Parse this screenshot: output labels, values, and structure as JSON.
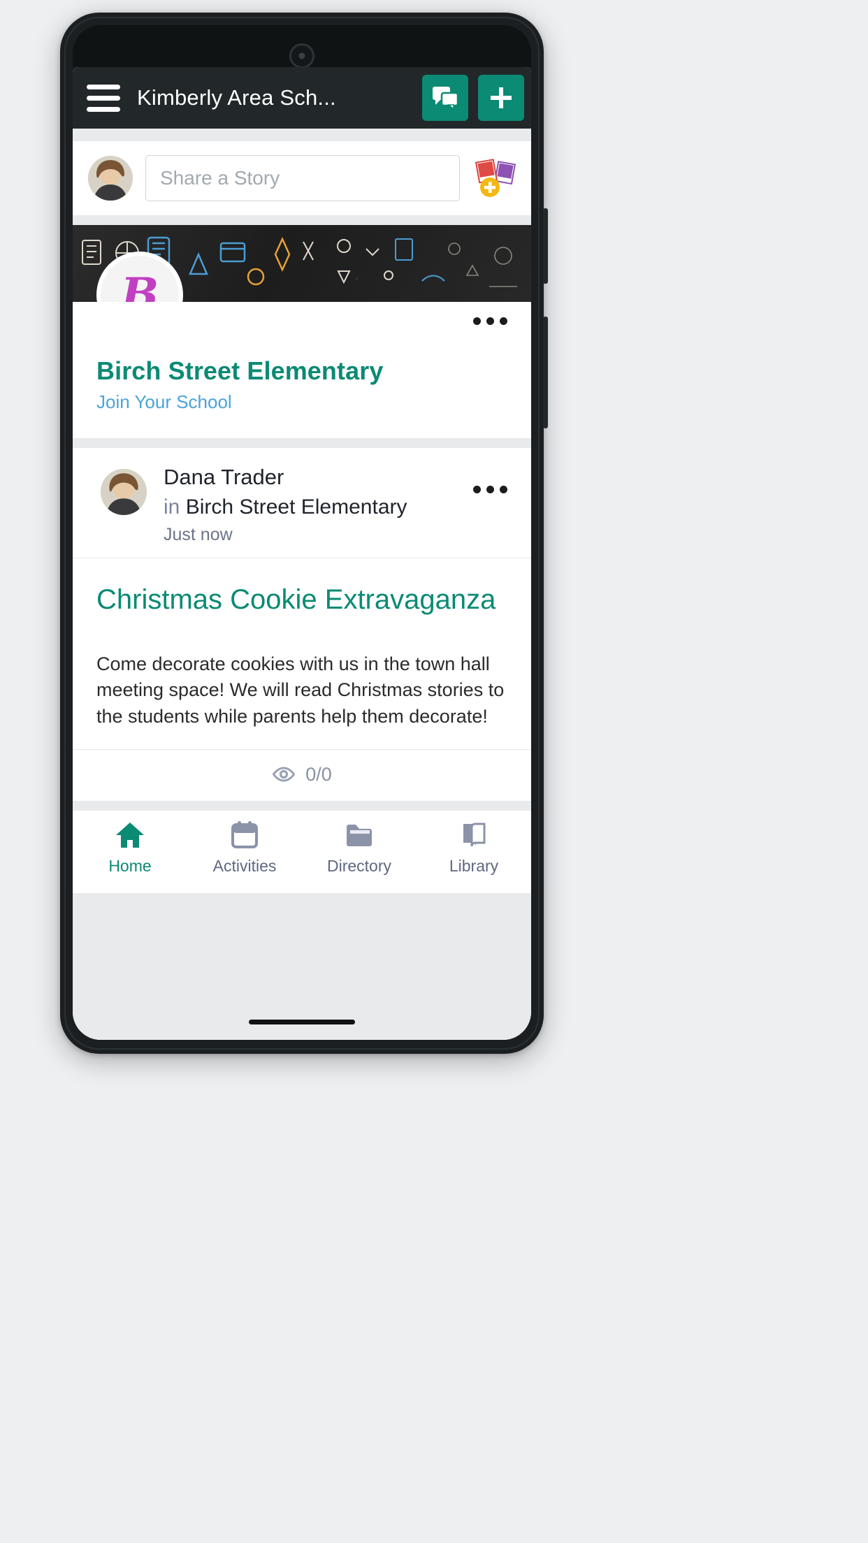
{
  "app_bar": {
    "menu_icon": "hamburger-menu-icon",
    "title": "Kimberly Area Sch...",
    "messages_icon": "chat-bubbles-icon",
    "add_icon": "plus-icon",
    "accent_color": "#0b8a74",
    "background_color": "#22282a"
  },
  "composer": {
    "avatar_name": "user-avatar",
    "placeholder": "Share a Story",
    "value": "",
    "photo_icon": "add-photo-icon"
  },
  "school_card": {
    "logo_letter": "B",
    "name": "Birch Street Elementary",
    "join_link": "Join Your School",
    "more_icon": "more-options-icon",
    "name_color": "#0b8a74",
    "link_color": "#4aa3da"
  },
  "post": {
    "author": "Dana Trader",
    "context_prefix": "in",
    "context_group": "Birch Street Elementary",
    "time": "Just now",
    "more_icon": "more-options-icon",
    "title": "Christmas Cookie Extravaganza",
    "text": "Come decorate cookies with us in the town hall meeting space! We will read Christmas stories to the students while parents help them decorate!",
    "views_icon": "eye-icon",
    "views": "0/0",
    "title_color": "#0b8a74"
  },
  "bottom_nav": {
    "items": [
      {
        "label": "Home",
        "icon": "home-icon",
        "active": true
      },
      {
        "label": "Activities",
        "icon": "calendar-icon",
        "active": false
      },
      {
        "label": "Directory",
        "icon": "folder-icon",
        "active": false
      },
      {
        "label": "Library",
        "icon": "book-icon",
        "active": false
      }
    ],
    "active_color": "#0b8a74",
    "inactive_color": "#5e6880"
  }
}
